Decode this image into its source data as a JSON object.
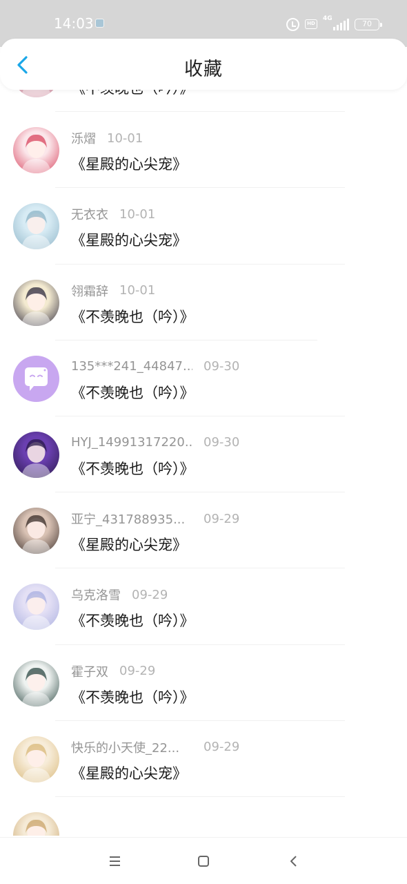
{
  "status_bar": {
    "time": "14:03",
    "network": "4G",
    "hd": "HD",
    "battery": "70",
    "icons": [
      "alarm-icon",
      "hd-icon",
      "signal-icon",
      "battery-icon"
    ]
  },
  "header": {
    "title": "收藏",
    "back_icon": "chevron-left-icon",
    "accent_color": "#1aa7e8"
  },
  "items": [
    {
      "username": "",
      "date": "",
      "title": "《不羡晚也（吟）》",
      "avatar": "anime-girl-pink-avatar",
      "colors": [
        "#f4d6dc",
        "#c98a9d"
      ]
    },
    {
      "username": "泺熠",
      "date": "10-01",
      "title": "《星殿的心尖宠》",
      "avatar": "anime-girl-red-hair-avatar",
      "colors": [
        "#fbe6ea",
        "#d8455f"
      ]
    },
    {
      "username": "无衣衣",
      "date": "10-01",
      "title": "《星殿的心尖宠》",
      "avatar": "anime-girl-white-avatar",
      "colors": [
        "#d7ebf4",
        "#8fb5c8"
      ]
    },
    {
      "username": "翎霜辞",
      "date": "10-01",
      "title": "《不羡晚也（吟）》",
      "avatar": "anime-pair-avatar",
      "colors": [
        "#f3ead0",
        "#2f2b3d"
      ]
    },
    {
      "username": "135***241_44847...",
      "date": "09-30",
      "title": "《不羡晚也（吟）》",
      "avatar": "default-chat-avatar",
      "colors": [
        "#c8a7f0",
        "#ffffff"
      ]
    },
    {
      "username": "HYJ_14991317220...",
      "date": "09-30",
      "title": "《不羡晚也（吟）》",
      "avatar": "anime-girl-purple-avatar",
      "colors": [
        "#6a3fb0",
        "#2a1a4a"
      ]
    },
    {
      "username": "亚宁_431788935...",
      "date": "09-29",
      "title": "《星殿的心尖宠》",
      "avatar": "woman-portrait-avatar",
      "colors": [
        "#d9c2b4",
        "#3a2e2a"
      ]
    },
    {
      "username": "乌克洛雪",
      "date": "09-29",
      "title": "《不羡晚也（吟）》",
      "avatar": "anime-girl-lilac-avatar",
      "colors": [
        "#e4e0f5",
        "#aab0e0"
      ]
    },
    {
      "username": "霍子双",
      "date": "09-29",
      "title": "《不羡晚也（吟）》",
      "avatar": "anime-boy-mask-avatar",
      "colors": [
        "#eef2f0",
        "#2e4a45"
      ]
    },
    {
      "username": "快乐的小天使_22...",
      "date": "09-29",
      "title": "《星殿的心尖宠》",
      "avatar": "anime-girl-blonde-avatar",
      "colors": [
        "#f7ecd9",
        "#d9b97a"
      ]
    },
    {
      "username": "",
      "date": "",
      "title": "",
      "avatar": "anime-girl-partial-avatar",
      "colors": [
        "#f5ead6",
        "#c9a46a"
      ]
    }
  ],
  "bottom_nav": {
    "icons": [
      "menu-icon",
      "home-square-icon",
      "back-triangle-icon"
    ]
  }
}
